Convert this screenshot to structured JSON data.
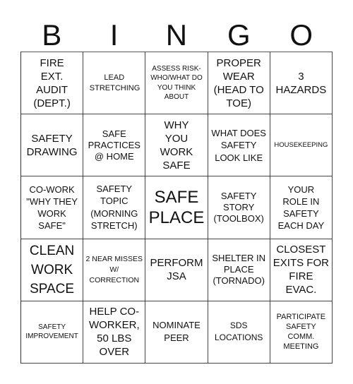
{
  "header": {
    "letters": [
      "B",
      "I",
      "N",
      "G",
      "O"
    ]
  },
  "grid": {
    "rows": [
      [
        "FIRE EXT. AUDIT (DEPT.)",
        "LEAD STRETCHING",
        "ASSESS RISK- WHO/WHAT DO YOU THINK ABOUT",
        "PROPER WEAR (HEAD TO TOE)",
        "3 HAZARDS"
      ],
      [
        "SAFETY DRAWING",
        "SAFE PRACTICES @ HOME",
        "WHY YOU WORK SAFE",
        "WHAT DOES SAFETY LOOK LIKE",
        "HOUSEKEEPING"
      ],
      [
        "CO-WORK \"WHY THEY WORK SAFE\"",
        "SAFETY TOPIC (MORNING STRETCH)",
        "SAFE PLACE",
        "SAFETY STORY (TOOLBOX)",
        "YOUR ROLE IN SAFETY EACH DAY"
      ],
      [
        "CLEAN WORK SPACE",
        "2 NEAR MISSES W/ CORRECTION",
        "PERFORM JSA",
        "SHELTER IN PLACE (TORNADO)",
        "CLOSEST EXITS FOR FIRE EVAC."
      ],
      [
        "SAFETY IMPROVEMENT",
        "HELP CO-WORKER, 50 LBS OVER",
        "NOMINATE PEER",
        "SDS LOCATIONS",
        "PARTICIPATE SAFETY COMM. MEETING"
      ]
    ]
  }
}
